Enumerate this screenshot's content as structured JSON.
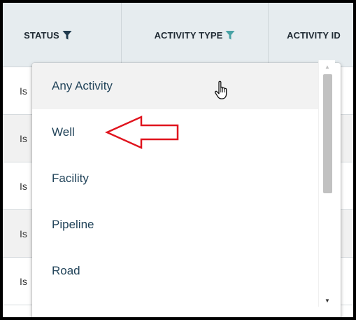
{
  "table": {
    "columns": [
      {
        "label": "STATUS",
        "filter_icon": "funnel-filled-icon",
        "filter_active": true
      },
      {
        "label": "ACTIVITY TYPE",
        "filter_icon": "funnel-filled-icon",
        "filter_active": true
      },
      {
        "label": "ACTIVITY ID"
      }
    ],
    "rows": [
      {
        "status": "Is"
      },
      {
        "status": "Is"
      },
      {
        "status": "Is"
      },
      {
        "status": "Is"
      },
      {
        "status": "Is"
      }
    ]
  },
  "dropdown": {
    "options": [
      "Any Activity",
      "Well",
      "Facility",
      "Pipeline",
      "Road"
    ],
    "highlighted_option": "Any Activity",
    "annotated_option": "Well"
  },
  "colors": {
    "header_bg": "#e6ecef",
    "status_filter_icon": "#1f3a4d",
    "type_filter_icon": "#4aa3a6",
    "option_text": "#22445a",
    "annotation_arrow": "#e0141e"
  },
  "icons": {
    "cursor": "hand-pointer-icon",
    "annotation": "red-left-arrow-icon"
  }
}
